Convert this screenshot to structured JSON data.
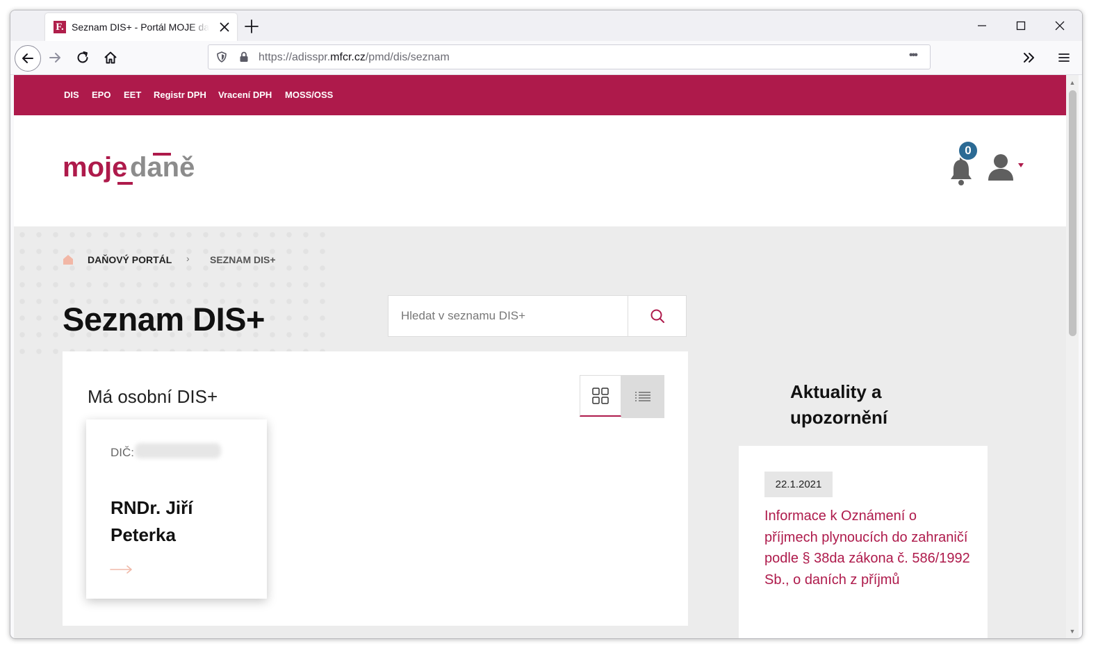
{
  "browser": {
    "tab_title": "Seznam DIS+ - Portál MOJE daně",
    "favicon_letter": "F.",
    "url_prefix": "https://adisspr.",
    "url_host": "mfcr.cz",
    "url_path": "/pmd/dis/seznam",
    "page_actions": "•••"
  },
  "colors": {
    "brand": "#ae1a4b",
    "badge": "#2b6a94",
    "logo_grey": "#8c8c8c"
  },
  "topnav": {
    "items": [
      "DIS",
      "EPO",
      "EET",
      "Registr DPH",
      "Vracení DPH",
      "MOSS/OSS"
    ]
  },
  "header": {
    "logo_part1": "moje",
    "logo_part2": "daně",
    "notifications_count": "0"
  },
  "breadcrumb": {
    "home": "Daňový portál",
    "separator": "›",
    "current": "Seznam DIS+"
  },
  "page": {
    "title": "Seznam DIS+",
    "search_placeholder": "Hledat v seznamu DIS+"
  },
  "panel": {
    "title": "Má osobní DIS+",
    "card": {
      "dic_label": "DIČ:",
      "name": "RNDr. Jiří Peterka"
    }
  },
  "aktuality": {
    "title": "Aktuality a upozornění",
    "news": [
      {
        "date": "22.1.2021",
        "text": "Informace k Oznámení o příjmech plynoucích do zahraničí podle § 38da zákona č. 586/1992 Sb., o daních z příjmů"
      }
    ]
  }
}
